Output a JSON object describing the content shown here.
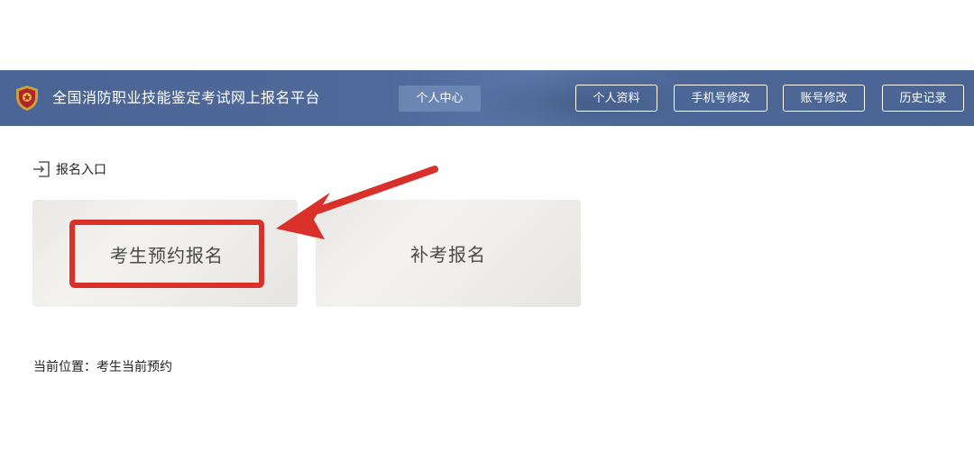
{
  "header": {
    "site_title": "全国消防职业技能鉴定考试网上报名平台",
    "center_tab": "个人中心",
    "nav_buttons": [
      "个人资料",
      "手机号修改",
      "账号修改",
      "历史记录"
    ]
  },
  "section": {
    "label": "报名入口"
  },
  "cards": [
    {
      "label": "考生预约报名"
    },
    {
      "label": "补考报名"
    }
  ],
  "breadcrumb": {
    "text": "当前位置：考生当前预约"
  },
  "icons": {
    "emblem": "fire-rescue-emblem-icon",
    "section": "entry-login-icon"
  },
  "colors": {
    "header_bg": "#4a6595",
    "center_tab_bg": "#6b86b3",
    "highlight": "#d9302a"
  }
}
